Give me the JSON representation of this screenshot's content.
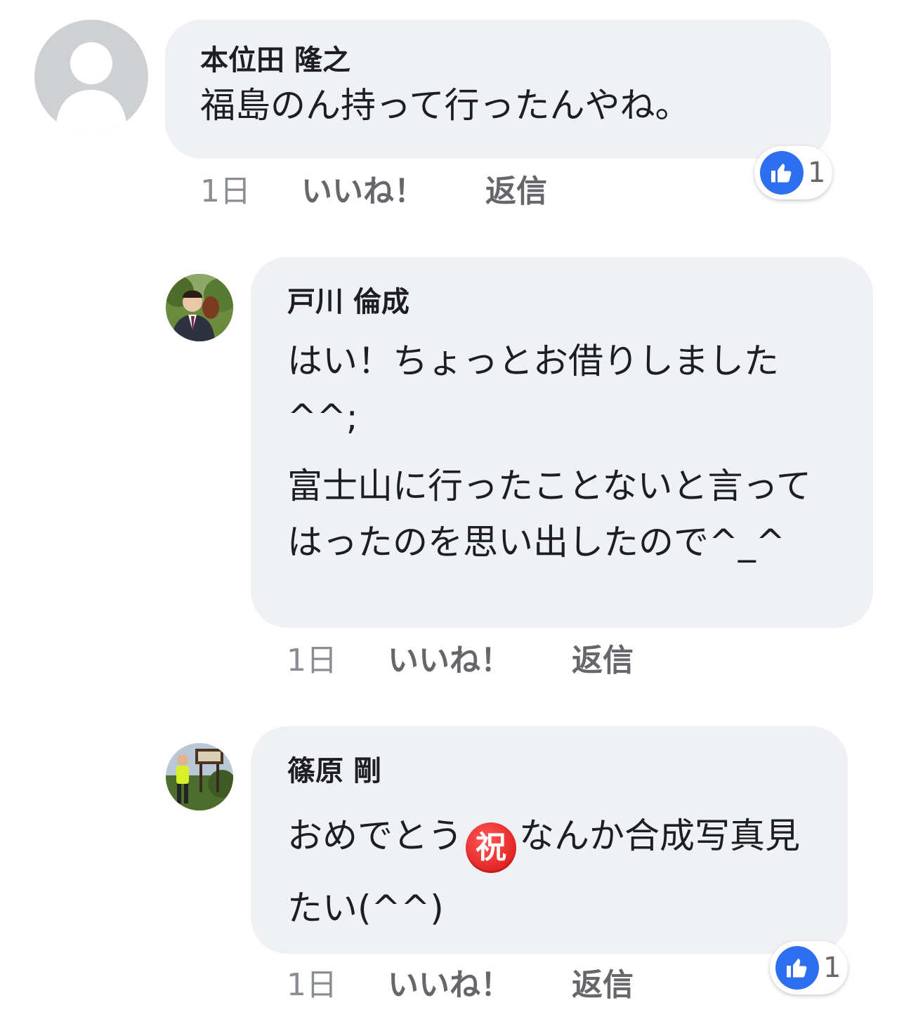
{
  "comments": [
    {
      "author": "本位田 隆之",
      "text": [
        "福島のん持って行ったんやね。"
      ],
      "time": "1日",
      "like_label": "いいね！",
      "reply_label": "返信",
      "reaction_count": "1",
      "avatar_icon": "default-user-silhouette-icon"
    },
    {
      "author": "戸川 倫成",
      "text": [
        "はい！ちょっとお借りしました^^;",
        "富士山に行ったことないと言ってはったのを思い出したので^_^"
      ],
      "time": "1日",
      "like_label": "いいね！",
      "reply_label": "返信",
      "avatar_icon": "profile-photo"
    },
    {
      "author": "篠原 剛",
      "text_before_emoji": "おめでとう",
      "emoji": "祝",
      "text_after_emoji": "なんか合成写真見たい(^^)",
      "time": "1日",
      "like_label": "いいね！",
      "reply_label": "返信",
      "reaction_count": "1",
      "avatar_icon": "profile-photo"
    }
  ],
  "colors": {
    "bubble": "#f0f1f4",
    "like_blue": "#2e6ff0",
    "action_text": "#65676b",
    "emoji_red": "#e01b1b"
  }
}
